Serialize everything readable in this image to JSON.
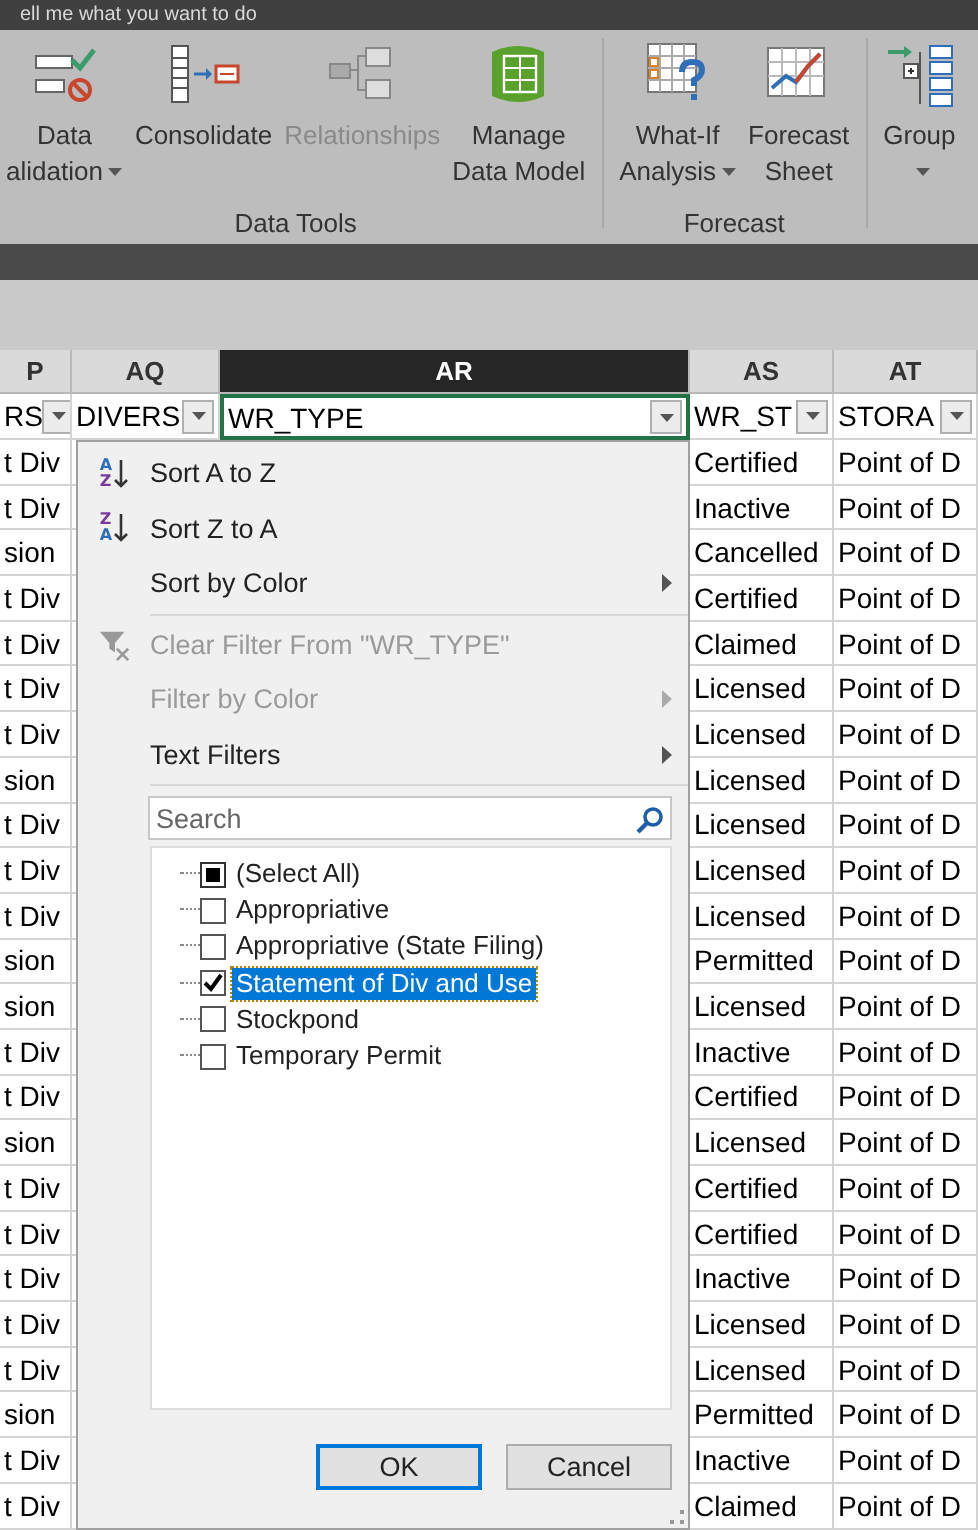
{
  "tell_me": {
    "text": "ell me what you want to do"
  },
  "ribbon": {
    "groups": [
      {
        "label": "Data Tools",
        "buttons": [
          {
            "lines": [
              "Data",
              "alidation"
            ],
            "dropdown": true,
            "disabled": false
          },
          {
            "lines": [
              "Consolidate"
            ],
            "dropdown": false,
            "disabled": false
          },
          {
            "lines": [
              "Relationships"
            ],
            "dropdown": false,
            "disabled": true
          },
          {
            "lines": [
              "Manage",
              "Data Model"
            ],
            "dropdown": false,
            "disabled": false
          }
        ]
      },
      {
        "label": "Forecast",
        "buttons": [
          {
            "lines": [
              "What-If",
              "Analysis"
            ],
            "dropdown": true,
            "disabled": false
          },
          {
            "lines": [
              "Forecast",
              "Sheet"
            ],
            "dropdown": false,
            "disabled": false
          }
        ]
      },
      {
        "buttons": [
          {
            "lines": [
              "Group"
            ],
            "dropdown": true,
            "disabled": false
          }
        ]
      }
    ]
  },
  "sheet": {
    "columns": [
      {
        "letter": "P",
        "header": "RS",
        "selected": false
      },
      {
        "letter": "AQ",
        "header": "DIVERS",
        "selected": false
      },
      {
        "letter": "AR",
        "header": "WR_TYPE",
        "selected": true
      },
      {
        "letter": "AS",
        "header": "WR_ST",
        "selected": false
      },
      {
        "letter": "AT",
        "header": "STORA",
        "selected": false
      }
    ],
    "rows": [
      [
        "t Div",
        "Certified",
        "Point of D"
      ],
      [
        "t Div",
        "Inactive",
        "Point of D"
      ],
      [
        "sion",
        "Cancelled",
        "Point of D"
      ],
      [
        "t Div",
        "Certified",
        "Point of D"
      ],
      [
        "t Div",
        "Claimed",
        "Point of D"
      ],
      [
        "t Div",
        "Licensed",
        "Point of D"
      ],
      [
        "t Div",
        "Licensed",
        "Point of D"
      ],
      [
        "sion",
        "Licensed",
        "Point of D"
      ],
      [
        "t Div",
        "Licensed",
        "Point of D"
      ],
      [
        "t Div",
        "Licensed",
        "Point of D"
      ],
      [
        "t Div",
        "Licensed",
        "Point of D"
      ],
      [
        "sion",
        "Permitted",
        "Point of D"
      ],
      [
        "sion",
        "Licensed",
        "Point of D"
      ],
      [
        "t Div",
        "Inactive",
        "Point of D"
      ],
      [
        "t Div",
        "Certified",
        "Point of D"
      ],
      [
        "sion",
        "Licensed",
        "Point of D"
      ],
      [
        "t Div",
        "Certified",
        "Point of D"
      ],
      [
        "t Div",
        "Certified",
        "Point of D"
      ],
      [
        "t Div",
        "Inactive",
        "Point of D"
      ],
      [
        "t Div",
        "Licensed",
        "Point of D"
      ],
      [
        "t Div",
        "Licensed",
        "Point of D"
      ],
      [
        "sion",
        "Permitted",
        "Point of D"
      ],
      [
        "t Div",
        "Inactive",
        "Point of D"
      ],
      [
        "t Div",
        "Claimed",
        "Point of D"
      ]
    ]
  },
  "filter_menu": {
    "items": [
      {
        "kind": "command",
        "icon_letters": [
          "A",
          "Z"
        ],
        "label": "Sort A to Z",
        "disabled": false,
        "submenu": false
      },
      {
        "kind": "command",
        "icon_letters": [
          "Z",
          "A"
        ],
        "label": "Sort Z to A",
        "disabled": false,
        "submenu": false
      },
      {
        "kind": "command",
        "label": "Sort by Color",
        "disabled": false,
        "submenu": true
      },
      {
        "kind": "separator"
      },
      {
        "kind": "command",
        "label": "Clear Filter From \"WR_TYPE\"",
        "disabled": true,
        "submenu": false
      },
      {
        "kind": "command",
        "label": "Filter by Color",
        "disabled": true,
        "submenu": true
      },
      {
        "kind": "command",
        "label": "Text Filters",
        "disabled": false,
        "submenu": true
      },
      {
        "kind": "separator"
      }
    ],
    "search": {
      "placeholder": "Search"
    },
    "values": [
      {
        "label": "(Select All)",
        "checked": false,
        "indeterminate": true,
        "selected": false
      },
      {
        "label": "Appropriative",
        "checked": false,
        "indeterminate": false,
        "selected": false
      },
      {
        "label": "Appropriative (State Filing)",
        "checked": false,
        "indeterminate": false,
        "selected": false
      },
      {
        "label": "Statement of Div and Use",
        "checked": true,
        "indeterminate": false,
        "selected": true
      },
      {
        "label": "Stockpond",
        "checked": false,
        "indeterminate": false,
        "selected": false
      },
      {
        "label": "Temporary Permit",
        "checked": false,
        "indeterminate": false,
        "selected": false
      }
    ],
    "buttons": [
      {
        "label": "OK",
        "default": true
      },
      {
        "label": "Cancel",
        "default": false
      }
    ]
  }
}
